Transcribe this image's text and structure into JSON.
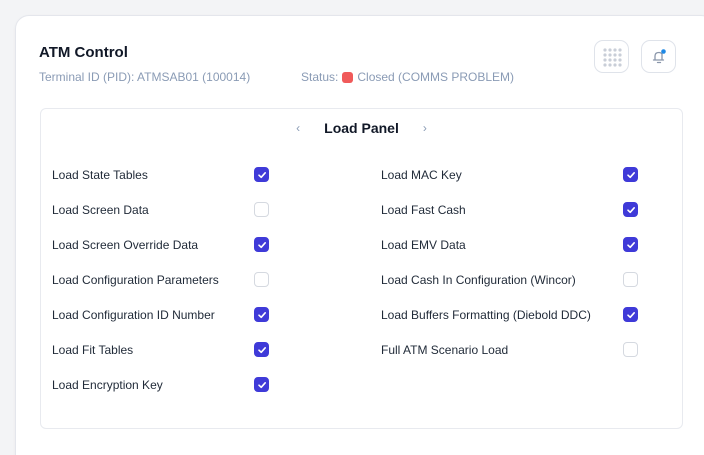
{
  "header": {
    "title": "ATM Control",
    "terminal": "Terminal ID (PID): ATMSAB01 (100014)",
    "status_label": "Status:",
    "status_value": "Closed (COMMS PROBLEM)",
    "status_color": "#f05a5a"
  },
  "panel": {
    "title": "Load Panel",
    "prev": "‹",
    "next": "›"
  },
  "accent": "#3f3ad8",
  "left_items": [
    {
      "label": "Load State Tables",
      "checked": true
    },
    {
      "label": "Load Screen Data",
      "checked": false
    },
    {
      "label": "Load Screen Override Data",
      "checked": true
    },
    {
      "label": "Load Configuration Parameters",
      "checked": false
    },
    {
      "label": "Load Configuration ID Number",
      "checked": true
    },
    {
      "label": "Load Fit Tables",
      "checked": true
    },
    {
      "label": "Load Encryption Key",
      "checked": true
    }
  ],
  "right_items": [
    {
      "label": "Load MAC Key",
      "checked": true
    },
    {
      "label": "Load Fast Cash",
      "checked": true
    },
    {
      "label": "Load EMV Data",
      "checked": true
    },
    {
      "label": "Load Cash In Configuration (Wincor)",
      "checked": false
    },
    {
      "label": "Load Buffers Formatting (Diebold DDC)",
      "checked": true
    },
    {
      "label": "Full ATM Scenario Load",
      "checked": false
    }
  ],
  "icons": {
    "grid": "grid-dots-icon",
    "bell": "notification-bell-icon"
  }
}
